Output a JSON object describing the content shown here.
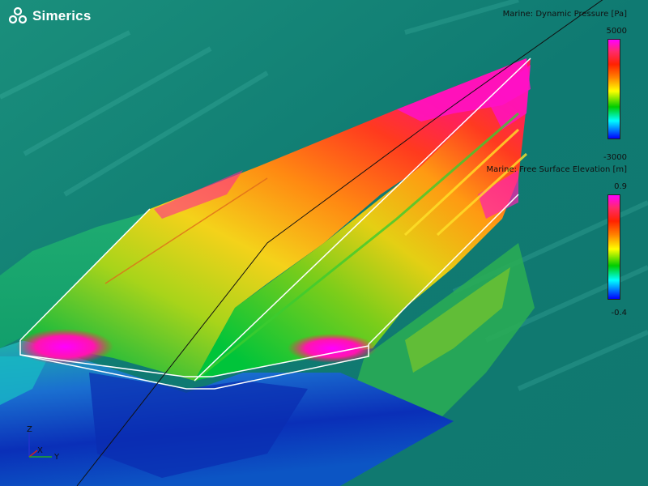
{
  "brand": {
    "name": "Simerics"
  },
  "legends": [
    {
      "title": "Marine: Dynamic Pressure [Pa]",
      "max": "5000",
      "min": "-3000"
    },
    {
      "title": "Marine: Free Surface Elevation [m]",
      "max": "0.9",
      "min": "-0.4"
    }
  ],
  "axes": {
    "z": "Z",
    "x": "X",
    "y": "Y"
  },
  "colors": {
    "water": "#0f7a72",
    "scale": [
      "#ff00ff",
      "#ff2200",
      "#ff8000",
      "#ffff00",
      "#00cc00",
      "#00ffff",
      "#0000ff"
    ]
  }
}
